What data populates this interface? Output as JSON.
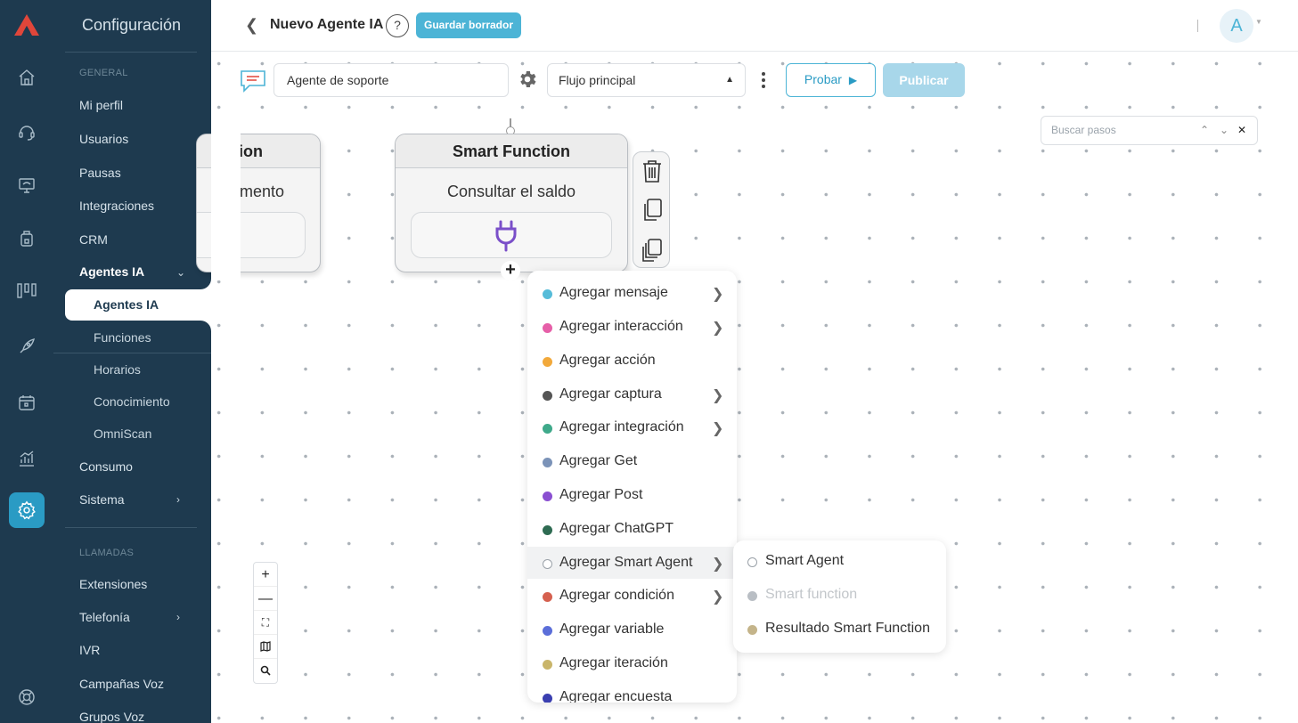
{
  "sidebar": {
    "title": "Configuración",
    "section_general": "GENERAL",
    "items": [
      "Mi perfil",
      "Usuarios",
      "Pausas",
      "Integraciones",
      "CRM"
    ],
    "group_title": "Agentes IA",
    "group_active": "Agentes IA",
    "group_items": [
      "Funciones",
      "Horarios",
      "Conocimiento",
      "OmniScan"
    ],
    "items2": [
      "Consumo",
      "Sistema"
    ],
    "section_calls": "LLAMADAS",
    "items3": [
      "Extensiones",
      "Telefonía",
      "IVR",
      "Campañas Voz",
      "Grupos Voz"
    ]
  },
  "header": {
    "title": "Nuevo Agente IA",
    "help": "?",
    "draft_button": "Guardar borrador",
    "avatar": "A"
  },
  "toolbar": {
    "agent_name": "Agente de soporte",
    "flow_select": "Flujo principal",
    "test_button": "Probar",
    "publish_button": "Publicar"
  },
  "search": {
    "placeholder": "Buscar pasos"
  },
  "nodes": {
    "left": {
      "title": "ion",
      "body": "mento"
    },
    "main": {
      "title": "Smart Function",
      "body": "Consultar el saldo"
    }
  },
  "menu": {
    "items": [
      {
        "label": "Agregar mensaje",
        "color": "#56bcd9",
        "submenu": true
      },
      {
        "label": "Agregar interacción",
        "color": "#e65fa8",
        "submenu": true
      },
      {
        "label": "Agregar acción",
        "color": "#f2a93b",
        "submenu": false
      },
      {
        "label": "Agregar captura",
        "color": "#555555",
        "submenu": true
      },
      {
        "label": "Agregar integración",
        "color": "#3fa98a",
        "submenu": true
      },
      {
        "label": "Agregar Get",
        "color": "#7b93b8",
        "submenu": false
      },
      {
        "label": "Agregar Post",
        "color": "#8a4fd1",
        "submenu": false
      },
      {
        "label": "Agregar ChatGPT",
        "color": "#2e6b52",
        "submenu": false
      },
      {
        "label": "Agregar Smart Agent",
        "color": "outline",
        "submenu": true
      },
      {
        "label": "Agregar condición",
        "color": "#d5604f",
        "submenu": true
      },
      {
        "label": "Agregar variable",
        "color": "#5b6ed9",
        "submenu": false
      },
      {
        "label": "Agregar iteración",
        "color": "#c9b56a",
        "submenu": false
      },
      {
        "label": "Agregar encuesta",
        "color": "#3a3fb0",
        "submenu": false
      }
    ]
  },
  "submenu": {
    "items": [
      {
        "label": "Smart Agent",
        "color": "outline",
        "disabled": false
      },
      {
        "label": "Smart function",
        "color": "#b9bec4",
        "disabled": true
      },
      {
        "label": "Resultado Smart Function",
        "color": "#c4b48a",
        "disabled": false
      }
    ]
  },
  "colors": {
    "sidebar_bg": "#1e3a4f",
    "accent": "#4cb4d6",
    "logo": "#e0463a",
    "function_icon": "#7a4fc9"
  }
}
